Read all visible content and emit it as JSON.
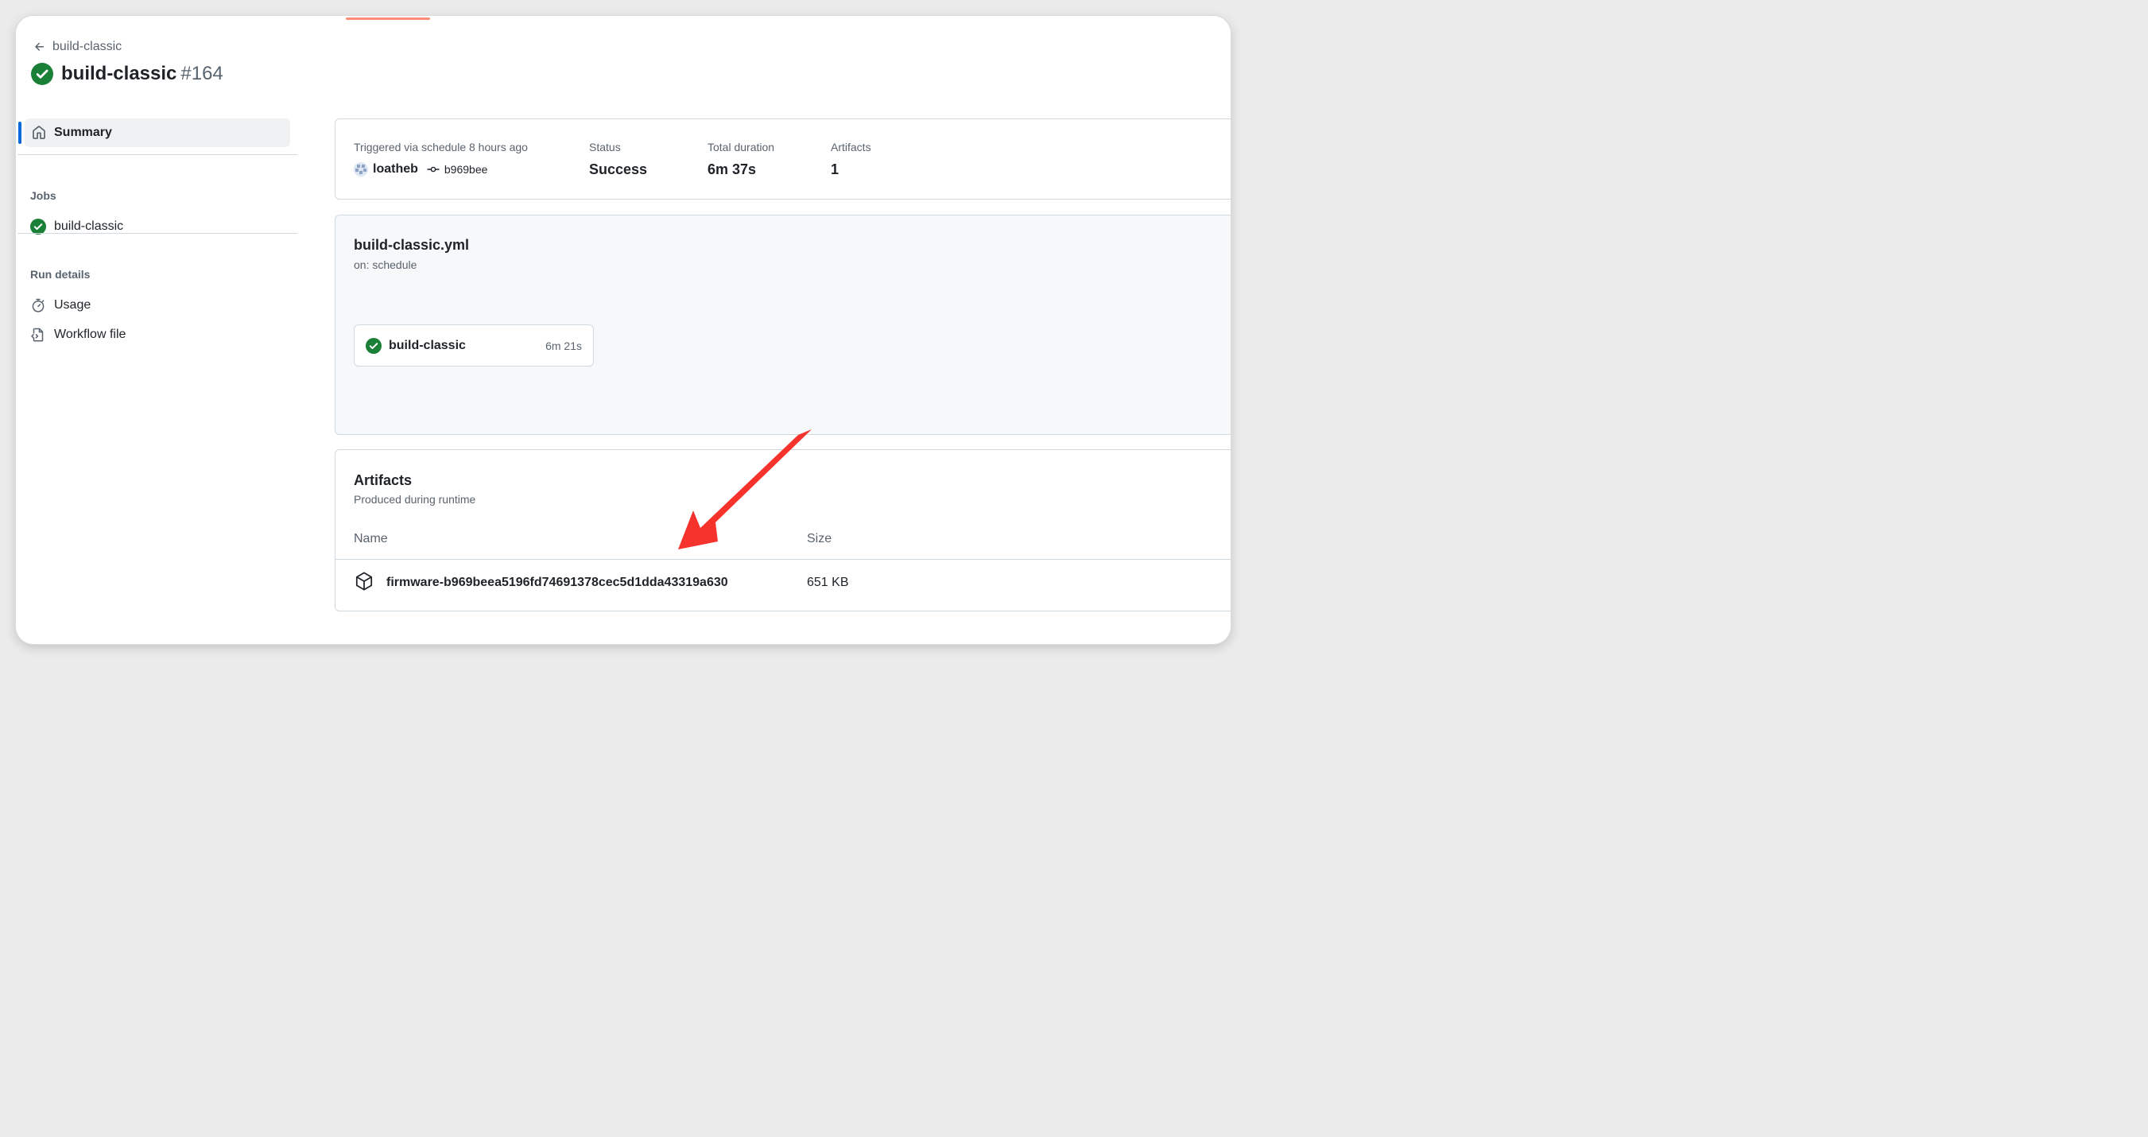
{
  "header": {
    "back_label": "build-classic",
    "title": "build-classic",
    "run_number": "#164"
  },
  "sidebar": {
    "summary_label": "Summary",
    "jobs_heading": "Jobs",
    "jobs": [
      {
        "label": "build-classic",
        "status": "success"
      }
    ],
    "run_details_heading": "Run details",
    "run_details": [
      {
        "label": "Usage",
        "icon": "stopwatch-icon"
      },
      {
        "label": "Workflow file",
        "icon": "file-code-icon"
      }
    ]
  },
  "run_summary": {
    "trigger_text": "Triggered via schedule 8 hours ago",
    "actor": "loatheb",
    "commit_sha": "b969bee",
    "status_label": "Status",
    "status_value": "Success",
    "duration_label": "Total duration",
    "duration_value": "6m 37s",
    "artifacts_label": "Artifacts",
    "artifacts_value": "1"
  },
  "workflow": {
    "file_name": "build-classic.yml",
    "trigger": "on: schedule",
    "jobs": [
      {
        "name": "build-classic",
        "duration": "6m 21s",
        "status": "success"
      }
    ]
  },
  "artifacts": {
    "title": "Artifacts",
    "subtitle": "Produced during runtime",
    "columns": [
      "Name",
      "Size"
    ],
    "rows": [
      {
        "name": "firmware-b969beea5196fd74691378cec5d1dda43319a630",
        "size": "651 KB"
      }
    ]
  },
  "colors": {
    "success": "#1a7f37",
    "accent": "#0969da",
    "annotation_arrow": "#f5322b"
  }
}
